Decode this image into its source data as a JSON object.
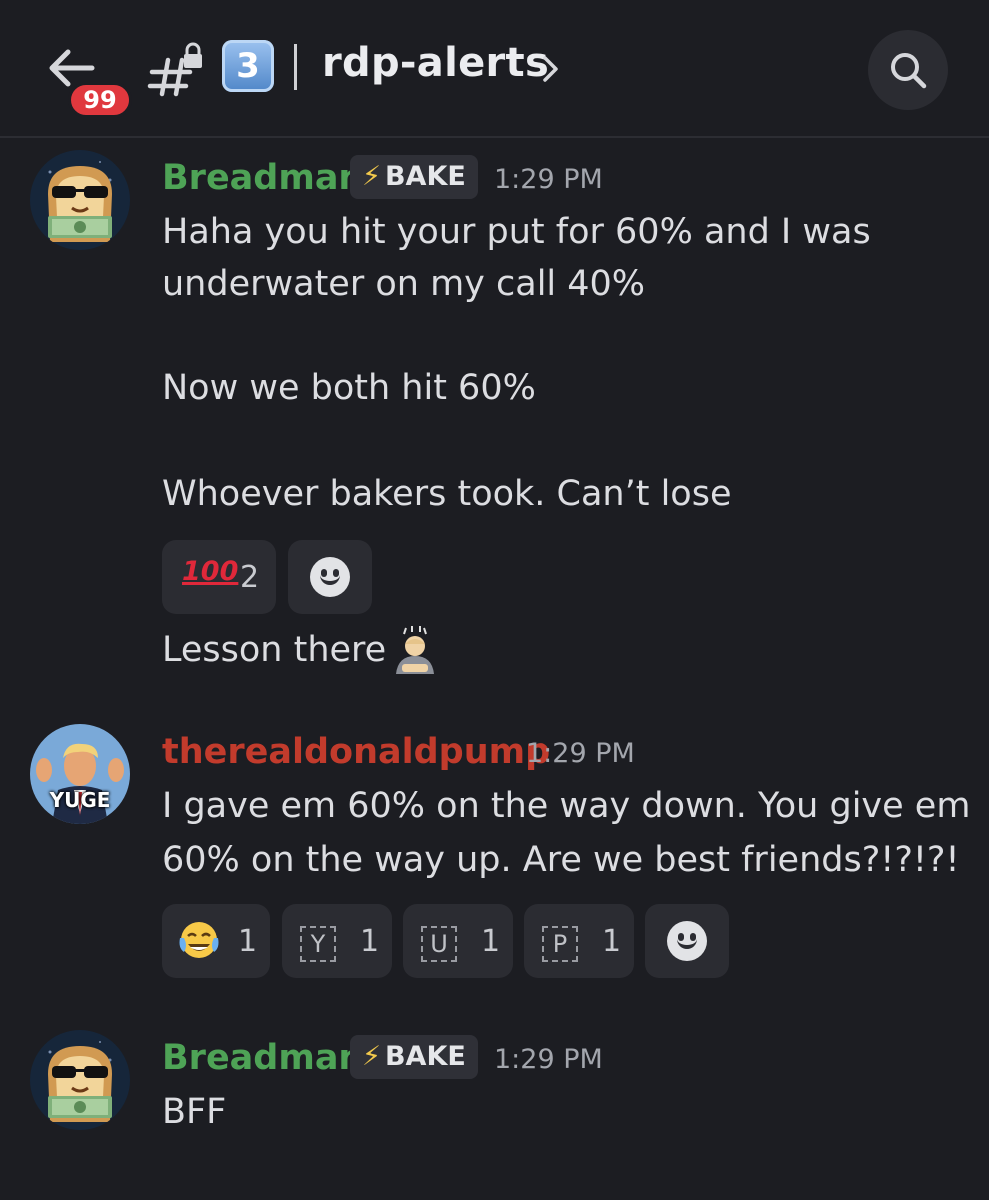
{
  "header": {
    "unread_count": "99",
    "channel_number": "3",
    "channel_name": "rdp-alerts"
  },
  "messages": [
    {
      "author": "Breadman",
      "author_color": "#4ea356",
      "tag": "BAKE",
      "time": "1:29 PM",
      "lines": [
        "Haha you hit your put for 60% and I was",
        "underwater on my call 40%",
        "Now we both hit 60%",
        "Whoever bakers took. Can’t lose"
      ],
      "reactions": [
        {
          "emoji": "hundred-points",
          "glyph": "100",
          "count": "2"
        }
      ],
      "followup": "Lesson there"
    },
    {
      "author": "therealdonaldpump",
      "author_color": "#c23b2c",
      "avatar_caption": "YUGE",
      "time": "1:29 PM",
      "lines": [
        "I gave em 60% on the way down. You give em",
        "60% on the way up. Are we best friends?!?!?!"
      ],
      "reactions": [
        {
          "emoji": "tears-of-joy",
          "count": "1"
        },
        {
          "letter": "Y",
          "count": "1"
        },
        {
          "letter": "U",
          "count": "1"
        },
        {
          "letter": "P",
          "count": "1"
        }
      ]
    },
    {
      "author": "Breadman",
      "author_color": "#4ea356",
      "tag": "BAKE",
      "time": "1:29 PM",
      "lines": [
        "BFF"
      ]
    }
  ],
  "colors": {
    "background": "#1c1d22",
    "badge": "#e0383e",
    "accent_blue": "#4f86c8"
  }
}
